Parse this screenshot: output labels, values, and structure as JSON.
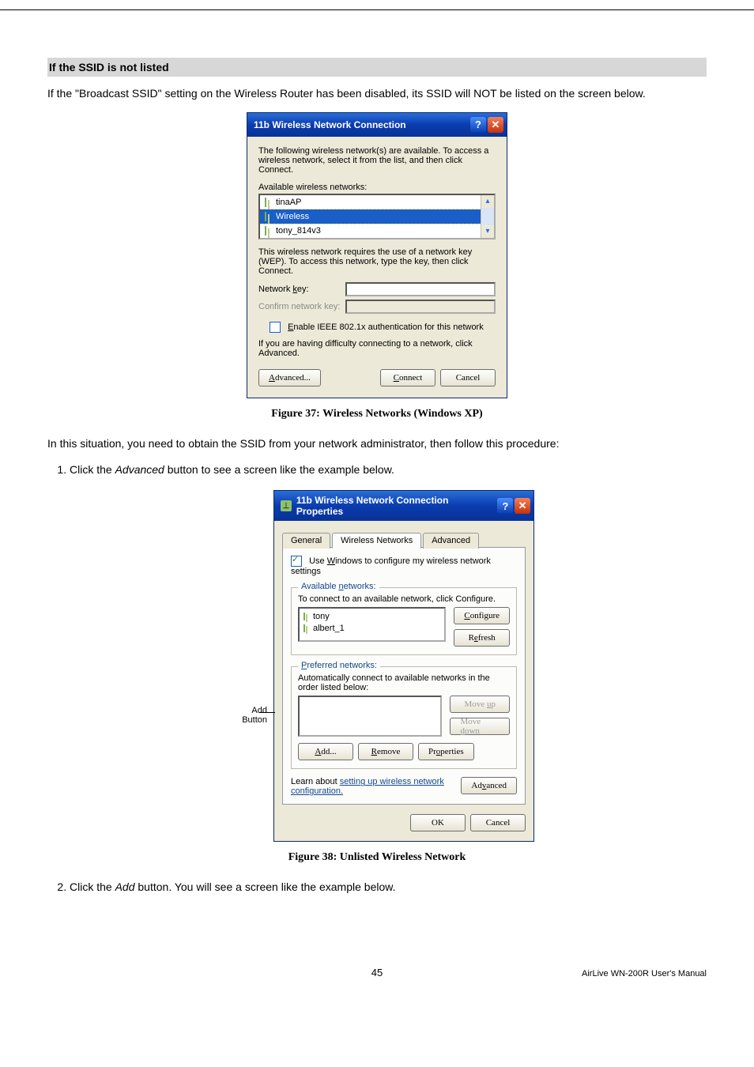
{
  "doc": {
    "section_heading": "If the SSID is not listed",
    "intro": "If the \"Broadcast SSID\" setting on the Wireless Router has been disabled, its SSID will NOT be listed on the screen below.",
    "caption1": "Figure 37: Wireless Networks (Windows XP)",
    "situation": "In this situation, you need to obtain the SSID from your network administrator, then follow this procedure:",
    "steps": [
      {
        "pre": "Click the ",
        "em": "Advanced",
        "post": " button to see a screen like the example below."
      },
      {
        "pre": "Click the ",
        "em": "Add",
        "post": " button. You will see a screen like the example below."
      }
    ],
    "caption2": "Figure 38: Unlisted Wireless Network",
    "callout_line1": "Add",
    "callout_line2": "Button",
    "page_number": "45",
    "manual": "AirLive WN-200R User's Manual"
  },
  "dialog1": {
    "title": "11b Wireless Network Connection",
    "help": "?",
    "close": "✕",
    "intro": "The following wireless network(s) are available. To access a wireless network, select it from the list, and then click Connect.",
    "available_label": "Available wireless networks:",
    "items": [
      "tinaAP",
      "Wireless",
      "tony_814v3"
    ],
    "selected_index": 1,
    "wep_note": "This wireless network requires the use of a network key (WEP). To access this network, type the key, then click Connect.",
    "network_key_label": "Network key:",
    "confirm_key_label": "Confirm network key:",
    "enable_8021x": "Enable IEEE 802.1x authentication for this network",
    "difficulty": "If you are having difficulty connecting to a network, click Advanced.",
    "advanced_btn": "Advanced...",
    "connect_btn": "Connect",
    "cancel_btn": "Cancel"
  },
  "dialog2": {
    "title": "11b Wireless Network Connection Properties",
    "help": "?",
    "close": "✕",
    "tabs": [
      "General",
      "Wireless Networks",
      "Advanced"
    ],
    "active_tab": 1,
    "use_windows": "Use Windows to configure my wireless network settings",
    "available_legend": "Available networks:",
    "available_hint": "To connect to an available network, click Configure.",
    "available_items": [
      "tony",
      "albert_1"
    ],
    "configure_btn": "Configure",
    "refresh_btn": "Refresh",
    "preferred_legend": "Preferred networks:",
    "preferred_hint": "Automatically connect to available networks in the order listed below:",
    "moveup_btn": "Move up",
    "movedown_btn": "Move down",
    "add_btn": "Add...",
    "remove_btn": "Remove",
    "properties_btn": "Properties",
    "learn_pre": "Learn about ",
    "learn_link": "setting up wireless network configuration.",
    "advanced_btn": "Advanced",
    "ok_btn": "OK",
    "cancel_btn": "Cancel"
  }
}
